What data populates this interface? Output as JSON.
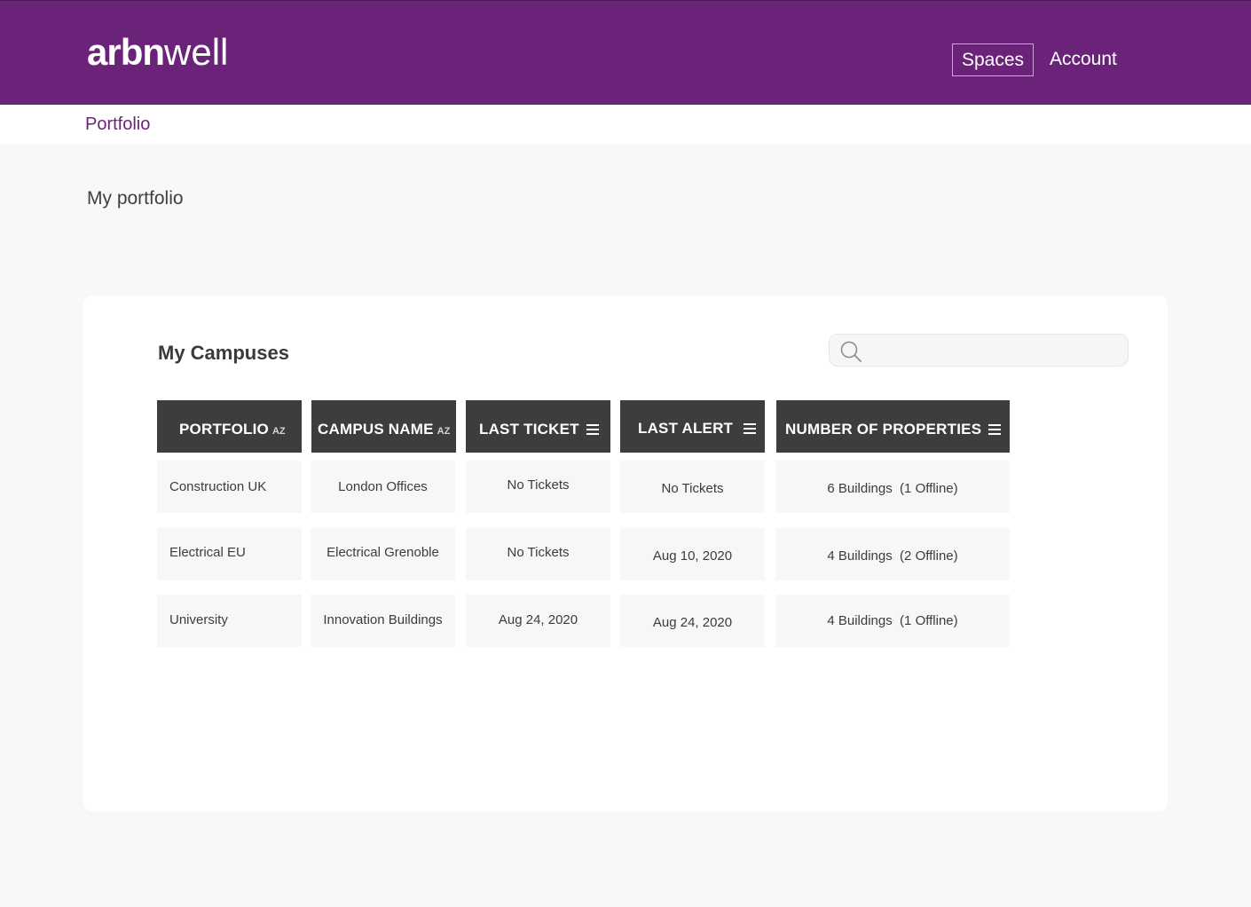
{
  "header": {
    "logo_bold": "arbn",
    "logo_light": "well",
    "nav": {
      "spaces": "Spaces",
      "account": "Account"
    }
  },
  "breadcrumb": "Portfolio",
  "page_title": "My portfolio",
  "campuses": {
    "title": "My Campuses",
    "search": {
      "value": "",
      "placeholder": ""
    },
    "sort_label": "AZ",
    "columns": {
      "portfolio": "PORTFOLIO",
      "campus_name": "CAMPUS NAME",
      "last_ticket": "LAST TICKET",
      "last_alert": "LAST ALERT",
      "number_of_properties": "NUMBER OF PROPERTIES"
    },
    "rows": [
      {
        "portfolio": "Construction UK",
        "campus_name": "London Offices",
        "last_ticket": "No Tickets",
        "last_alert": "No Tickets",
        "number_of_properties": "6 Buildings  (1 Offline)"
      },
      {
        "portfolio": "Electrical EU",
        "campus_name": "Electrical Grenoble",
        "last_ticket": "No Tickets",
        "last_alert": "Aug 10, 2020",
        "number_of_properties": "4 Buildings  (2 Offline)"
      },
      {
        "portfolio": "University",
        "campus_name": "Innovation Buildings",
        "last_ticket": "Aug 24, 2020",
        "last_alert": "Aug 24, 2020",
        "number_of_properties": "4 Buildings  (1 Offline)"
      }
    ]
  },
  "colors": {
    "brand_purple": "#6b2379",
    "header_dark": "#3d3d3d",
    "cell_bg": "#f6f7f9",
    "page_bg": "#f7f8fa"
  }
}
